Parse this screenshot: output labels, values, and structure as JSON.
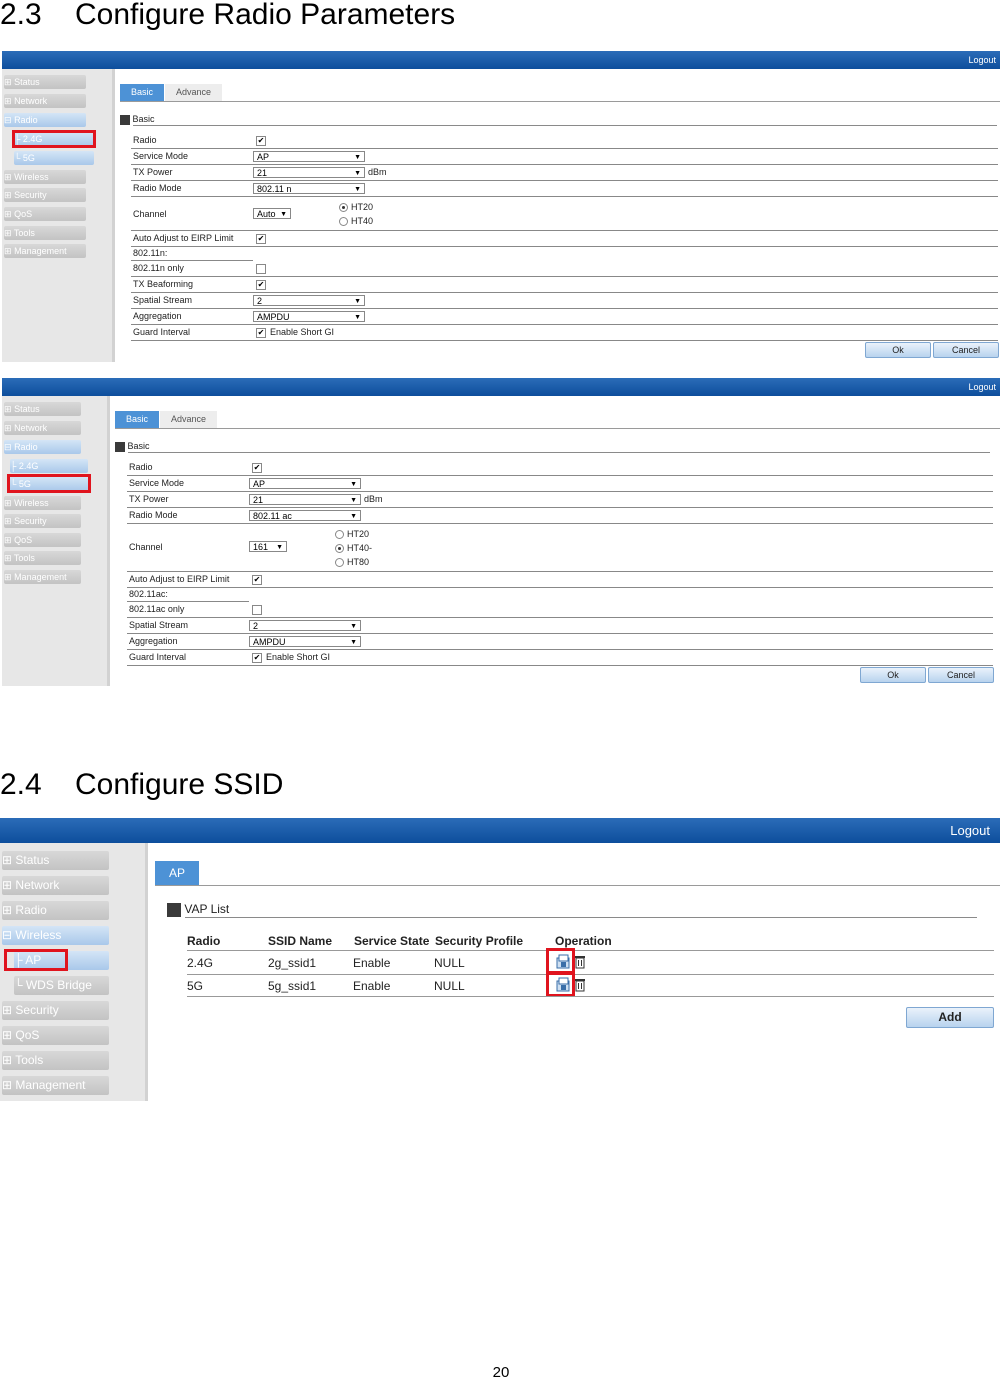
{
  "sections": [
    {
      "number": "2.3",
      "title": "Configure Radio Parameters"
    },
    {
      "number": "2.4",
      "title": "Configure SSID"
    }
  ],
  "topbar": {
    "logout": "Logout"
  },
  "radio24": {
    "nav": [
      {
        "label": "Status",
        "prefix": "⊞"
      },
      {
        "label": "Network",
        "prefix": "⊞"
      },
      {
        "label": "Radio",
        "prefix": "⊟"
      },
      {
        "label": "2.4G",
        "prefix": "├"
      },
      {
        "label": "5G",
        "prefix": "└"
      },
      {
        "label": "Wireless",
        "prefix": "⊞"
      },
      {
        "label": "Security",
        "prefix": "⊞"
      },
      {
        "label": "QoS",
        "prefix": "⊞"
      },
      {
        "label": "Tools",
        "prefix": "⊞"
      },
      {
        "label": "Management",
        "prefix": "⊞"
      }
    ],
    "tabs": [
      "Basic",
      "Advance"
    ],
    "group": "Basic",
    "fields": {
      "radio": "Radio",
      "service_mode": "Service Mode",
      "service_mode_val": "AP",
      "tx_power": "TX Power",
      "tx_power_val": "21",
      "tx_unit": "dBm",
      "radio_mode": "Radio Mode",
      "radio_mode_val": "802.11 n",
      "channel": "Channel",
      "channel_val": "Auto",
      "bw1": "HT20",
      "bw2": "HT40",
      "eirp": "Auto Adjust to EIRP Limit",
      "sub": "802.11n:",
      "only": "802.11n only",
      "beam": "TX Beaforming",
      "spatial": "Spatial Stream",
      "spatial_val": "2",
      "aggregation": "Aggregation",
      "aggregation_val": "AMPDU",
      "guard": "Guard Interval",
      "guard_val": "Enable Short GI"
    },
    "ok": "Ok",
    "cancel": "Cancel"
  },
  "radio5": {
    "nav": [
      {
        "label": "Status",
        "prefix": "⊞"
      },
      {
        "label": "Network",
        "prefix": "⊞"
      },
      {
        "label": "Radio",
        "prefix": "⊟"
      },
      {
        "label": "2.4G",
        "prefix": "├"
      },
      {
        "label": "5G",
        "prefix": "└"
      },
      {
        "label": "Wireless",
        "prefix": "⊞"
      },
      {
        "label": "Security",
        "prefix": "⊞"
      },
      {
        "label": "QoS",
        "prefix": "⊞"
      },
      {
        "label": "Tools",
        "prefix": "⊞"
      },
      {
        "label": "Management",
        "prefix": "⊞"
      }
    ],
    "tabs": [
      "Basic",
      "Advance"
    ],
    "group": "Basic",
    "fields": {
      "radio": "Radio",
      "service_mode": "Service Mode",
      "service_mode_val": "AP",
      "tx_power": "TX Power",
      "tx_power_val": "21",
      "tx_unit": "dBm",
      "radio_mode": "Radio Mode",
      "radio_mode_val": "802.11 ac",
      "channel": "Channel",
      "channel_val": "161",
      "bw1": "HT20",
      "bw2": "HT40-",
      "bw3": "HT80",
      "eirp": "Auto Adjust to EIRP Limit",
      "sub": "802.11ac:",
      "only": "802.11ac only",
      "spatial": "Spatial Stream",
      "spatial_val": "2",
      "aggregation": "Aggregation",
      "aggregation_val": "AMPDU",
      "guard": "Guard Interval",
      "guard_val": "Enable Short GI"
    },
    "ok": "Ok",
    "cancel": "Cancel"
  },
  "ssid": {
    "nav": [
      {
        "label": "Status",
        "prefix": "⊞"
      },
      {
        "label": "Network",
        "prefix": "⊞"
      },
      {
        "label": "Radio",
        "prefix": "⊞"
      },
      {
        "label": "Wireless",
        "prefix": "⊟"
      },
      {
        "label": "AP",
        "prefix": "├"
      },
      {
        "label": "WDS Bridge",
        "prefix": "└"
      },
      {
        "label": "Security",
        "prefix": "⊞"
      },
      {
        "label": "QoS",
        "prefix": "⊞"
      },
      {
        "label": "Tools",
        "prefix": "⊞"
      },
      {
        "label": "Management",
        "prefix": "⊞"
      }
    ],
    "tab": "AP",
    "group": "VAP List",
    "columns": [
      "Radio",
      "SSID Name",
      "Service State",
      "Security Profile",
      "Operation"
    ],
    "rows": [
      {
        "radio": "2.4G",
        "ssid": "2g_ssid1",
        "state": "Enable",
        "profile": "NULL"
      },
      {
        "radio": "5G",
        "ssid": "5g_ssid1",
        "state": "Enable",
        "profile": "NULL"
      }
    ],
    "add": "Add"
  },
  "page_number": "20",
  "icons": [
    "edit-icon",
    "trash-icon",
    "checkbox-checked-icon"
  ]
}
